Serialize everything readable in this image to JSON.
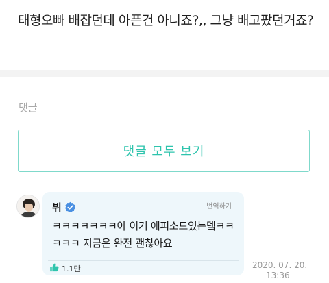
{
  "post": {
    "text": "태형오빠 배잡던데 아픈건 아니죠?,, 그냥 배고팠던거죠?"
  },
  "comments": {
    "label": "댓글",
    "view_all_label": "댓글 모두 보기",
    "items": [
      {
        "author": "뷔",
        "translate_label": "번역하기",
        "text": "ㅋㅋㅋㅋㅋㅋㅋ아 이거 에피소드있는뎈ㅋㅋㅋㅋㅋ 지금은 완전 괜찮아요",
        "likes": "1.1만",
        "date_line1": "2020. 07. 20.",
        "date_line2": "13:36"
      }
    ]
  },
  "colors": {
    "accent": "#2ec4ad",
    "accent_border": "#7fd9cb",
    "bubble_bg": "#eef7fb",
    "verified_blue": "#4a90e2"
  }
}
